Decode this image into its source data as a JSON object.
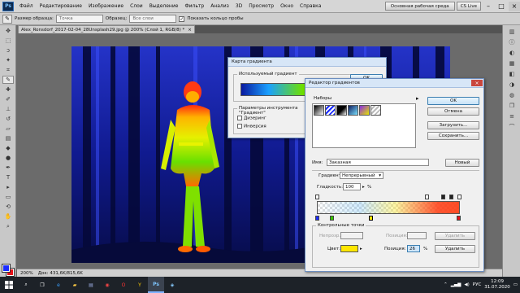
{
  "menubar": {
    "logo": "Ps",
    "items": [
      "Файл",
      "Редактирование",
      "Изображение",
      "Слои",
      "Выделение",
      "Фильтр",
      "Анализ",
      "3D",
      "Просмотр",
      "Окно",
      "Справка"
    ],
    "workspace": "Основная рабочая среда",
    "cslive": "CS Live"
  },
  "optionsbar": {
    "size_label": "Размер образца:",
    "size_value": "Точка",
    "sample_label": "Образец:",
    "sample_value": "Все слои",
    "ring_label": "Показать кольцо пробы"
  },
  "document": {
    "tab_title": "Alex_Ronsdorf_2017-02-04_28Unsplash29.jpg @ 200% (Слой 1, RGB/8) *",
    "close": "×"
  },
  "statusbar": {
    "zoom": "200%",
    "doc": "Док: 431,6K/815,6K"
  },
  "gradient_map": {
    "title": "Карта градиента",
    "used_gradient": "Используемый градиент",
    "ok": "OK",
    "tool_params": "Параметры инструмента \"Градиент\"",
    "dither": "Дизеринг",
    "invert": "Инверсия"
  },
  "gradient_editor": {
    "title": "Редактор градиентов",
    "presets_label": "Наборы",
    "ok": "OK",
    "cancel": "Отмена",
    "load": "Загрузить...",
    "save": "Сохранить...",
    "name_label": "Имя:",
    "name_value": "Заказная",
    "new": "Новый",
    "type_label": "Градиент:",
    "type_value": "Непрерывный",
    "smooth_label": "Гладкость:",
    "smooth_value": "100",
    "percent": "%",
    "stops_group": "Контрольные точки",
    "opacity_label": "Непрозр.:",
    "position_label": "Позиция:",
    "delete": "Удалить",
    "color_label": "Цвет:",
    "color_position_value": "26",
    "stop_color": "#ffe600"
  },
  "taskbar": {
    "lang": "РУС",
    "time": "12:09",
    "date": "31.07.2020",
    "ps_app": "Ps"
  },
  "colors": {
    "foreground": "#1b2cff",
    "background": "#e8121a"
  }
}
